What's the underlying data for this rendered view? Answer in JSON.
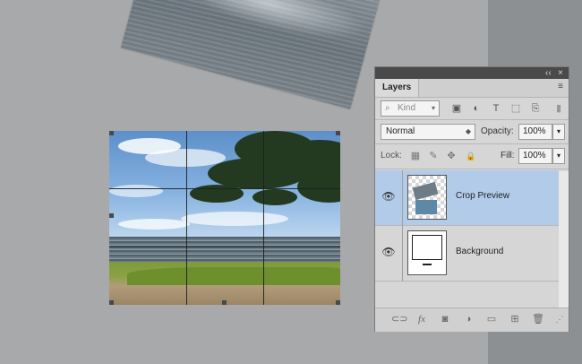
{
  "layers_panel": {
    "tab_label": "Layers",
    "collapse_label": "‹‹",
    "close_label": "×",
    "menu_label": "≡",
    "filter_placeholder": "Kind",
    "blend_mode": "Normal",
    "opacity_label": "Opacity:",
    "opacity_value": "100%",
    "lock_label": "Lock:",
    "fill_label": "Fill:",
    "fill_value": "100%",
    "layers": [
      {
        "name": "Crop Preview",
        "visible": true,
        "selected": true
      },
      {
        "name": "Background",
        "visible": true,
        "selected": false
      }
    ],
    "colors": {
      "selected_row": "#b1cbe9"
    }
  },
  "icons": {
    "search": "⌕",
    "image": "▣",
    "adjust": "◐",
    "type": "T",
    "shape": "⬚",
    "smart": "⎘",
    "toggle": "▮",
    "lock_pixels": "▦",
    "lock_paint": "✎",
    "lock_move": "✥",
    "lock_all": "🔒",
    "eye": "👁",
    "link": "⊂⊃",
    "fx": "fx",
    "mask": "◙",
    "adjustment": "◑",
    "group": "▭",
    "new_layer": "⊞",
    "delete": "🗑",
    "arrow": "▾",
    "dropdown": "◆",
    "resize": "⋰"
  }
}
